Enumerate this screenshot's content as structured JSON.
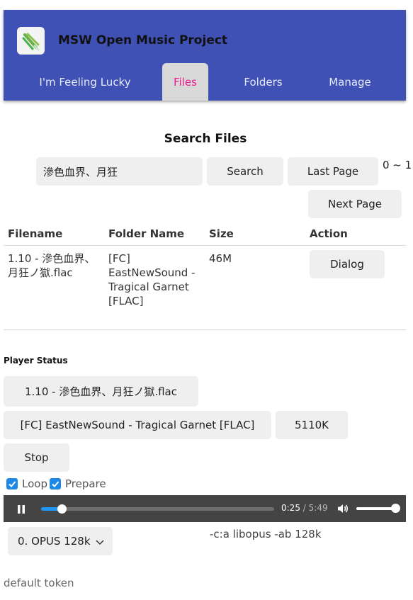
{
  "header": {
    "title": "MSW Open Music Project",
    "tabs": [
      {
        "label": "I'm Feeling Lucky"
      },
      {
        "label": "Files"
      },
      {
        "label": "Folders"
      },
      {
        "label": "Manage"
      }
    ],
    "active_tab": "Files",
    "colors": {
      "bar": "#3f51b5",
      "active_tab_text": "#e91e8c"
    }
  },
  "search": {
    "title": "Search Files",
    "query": "滲色血界、月狂",
    "search_label": "Search",
    "last_page_label": "Last Page",
    "next_page_label": "Next Page",
    "page_range": "0 ~ 1"
  },
  "table": {
    "headers": [
      "Filename",
      "Folder Name",
      "Size",
      "Action"
    ],
    "rows": [
      {
        "filename": "1.10 - 滲色血界、月狂ノ獄.flac",
        "folder": "[FC] EastNewSound - Tragical Garnet [FLAC]",
        "size": "46M",
        "action_label": "Dialog"
      }
    ]
  },
  "player": {
    "label": "Player Status",
    "file_name": "1.10 - 滲色血界、月狂ノ獄.flac",
    "folder_name": "[FC] EastNewSound - Tragical Garnet [FLAC]",
    "bitrate": "5110K",
    "stop_label": "Stop",
    "loop_label": "Loop",
    "prepare_label": "Prepare",
    "loop_checked": true,
    "prepare_checked": true,
    "current_time": "0:25",
    "duration": "5:49",
    "progress_fraction": 0.087,
    "volume_fraction": 1.0,
    "quality_selected": "0. OPUS 128k",
    "codec_args": "-c:a libopus -ab 128k",
    "token_text": "default token"
  }
}
